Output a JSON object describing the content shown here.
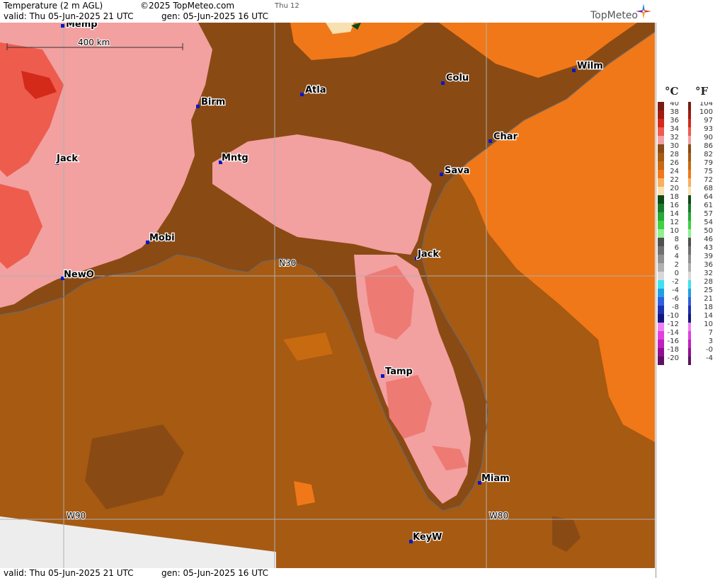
{
  "header": {
    "parameter": "Temperature (2 m AGL)",
    "copyright": "©2025 TopMeteo.com",
    "day_tab": "Thu 12",
    "valid": "valid:  Thu  05-Jun-2025  21 UTC",
    "generated": "gen:  05-Jun-2025 16 UTC",
    "logo": "TopMeteo"
  },
  "footer": {
    "valid": "valid:  Thu  05-Jun-2025  21 UTC",
    "generated": "gen:  05-Jun-2025 16 UTC"
  },
  "scale_bar": {
    "label": "400 km"
  },
  "grid_labels": {
    "lat": "N30",
    "lon_w90": "W90",
    "lon_w80": "W80"
  },
  "cities": [
    {
      "id": "memp",
      "name": "Memp"
    },
    {
      "id": "birm",
      "name": "Birm"
    },
    {
      "id": "atla",
      "name": "Atla"
    },
    {
      "id": "colu",
      "name": "Colu"
    },
    {
      "id": "wilm",
      "name": "Wilm"
    },
    {
      "id": "char",
      "name": "Char"
    },
    {
      "id": "sava",
      "name": "Sava"
    },
    {
      "id": "jack-ms",
      "name": "Jack"
    },
    {
      "id": "mntg",
      "name": "Mntg"
    },
    {
      "id": "mobi",
      "name": "Mobi"
    },
    {
      "id": "newo",
      "name": "NewO"
    },
    {
      "id": "jack-fl",
      "name": "Jack"
    },
    {
      "id": "tamp",
      "name": "Tamp"
    },
    {
      "id": "miam",
      "name": "Miam"
    },
    {
      "id": "keyw",
      "name": "KeyW"
    }
  ],
  "legend": {
    "unit_c": "°C",
    "unit_f": "°F",
    "rows": [
      {
        "c": "40",
        "f": "104",
        "color": "#7a1a10"
      },
      {
        "c": "38",
        "f": "100",
        "color": "#a01c10"
      },
      {
        "c": "36",
        "f": "97",
        "color": "#d42a1a"
      },
      {
        "c": "34",
        "f": "93",
        "color": "#ee5c4e"
      },
      {
        "c": "32",
        "f": "90",
        "color": "#f2a0a0"
      },
      {
        "c": "30",
        "f": "86",
        "color": "#8a4a14"
      },
      {
        "c": "28",
        "f": "82",
        "color": "#a65a12"
      },
      {
        "c": "26",
        "f": "79",
        "color": "#c86a10"
      },
      {
        "c": "24",
        "f": "75",
        "color": "#f07818"
      },
      {
        "c": "22",
        "f": "72",
        "color": "#f8b060"
      },
      {
        "c": "20",
        "f": "68",
        "color": "#f8e0b0"
      },
      {
        "c": "18",
        "f": "64",
        "color": "#0b4a1a"
      },
      {
        "c": "16",
        "f": "61",
        "color": "#1a7a2a"
      },
      {
        "c": "14",
        "f": "57",
        "color": "#26a83a"
      },
      {
        "c": "12",
        "f": "54",
        "color": "#40d040"
      },
      {
        "c": "10",
        "f": "50",
        "color": "#90f090"
      },
      {
        "c": "8",
        "f": "46",
        "color": "#505050"
      },
      {
        "c": "6",
        "f": "43",
        "color": "#707070"
      },
      {
        "c": "4",
        "f": "39",
        "color": "#909090"
      },
      {
        "c": "2",
        "f": "36",
        "color": "#b0b0b0"
      },
      {
        "c": "0",
        "f": "32",
        "color": "#d8d8d8"
      },
      {
        "c": "-2",
        "f": "28",
        "color": "#40e0f0"
      },
      {
        "c": "-4",
        "f": "25",
        "color": "#20a0e0"
      },
      {
        "c": "-6",
        "f": "21",
        "color": "#3060e0"
      },
      {
        "c": "-8",
        "f": "18",
        "color": "#2030b0"
      },
      {
        "c": "-10",
        "f": "14",
        "color": "#101880"
      },
      {
        "c": "-12",
        "f": "10",
        "color": "#f080f0"
      },
      {
        "c": "-14",
        "f": "7",
        "color": "#e040e0"
      },
      {
        "c": "-16",
        "f": "3",
        "color": "#c020c0"
      },
      {
        "c": "-18",
        "f": "-0",
        "color": "#901090"
      },
      {
        "c": "-20",
        "f": "-4",
        "color": "#601060"
      }
    ]
  }
}
